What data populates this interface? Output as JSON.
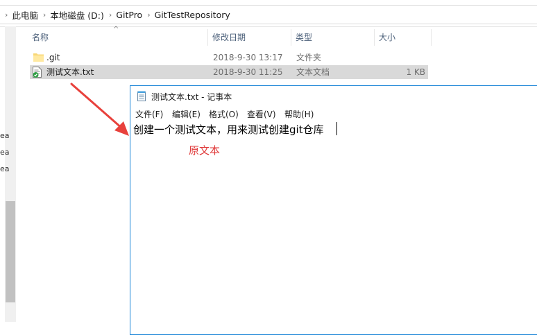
{
  "breadcrumb": {
    "items": [
      "此电脑",
      "本地磁盘 (D:)",
      "GitPro",
      "GitTestRepository"
    ],
    "separator": "›"
  },
  "left_pane": {
    "truncated_labels": [
      "ea",
      "ea",
      "ea"
    ]
  },
  "columns": {
    "name": "名称",
    "date": "修改日期",
    "type": "类型",
    "size": "大小"
  },
  "files": [
    {
      "name": ".git",
      "date": "2018-9-30 13:17",
      "type": "文件夹",
      "size": "",
      "icon": "folder-icon",
      "selected": false
    },
    {
      "name": "测试文本.txt",
      "date": "2018-9-30 11:25",
      "type": "文本文档",
      "size": "1 KB",
      "icon": "text-file-icon",
      "selected": true
    }
  ],
  "notepad": {
    "title": "测试文本.txt - 记事本",
    "menu": [
      "文件(F)",
      "编辑(E)",
      "格式(O)",
      "查看(V)",
      "帮助(H)"
    ],
    "content": "创建一个测试文本，用来测试创建git仓库"
  },
  "annotation": {
    "text": "原文本",
    "color": "#e03a3a"
  },
  "colors": {
    "selection": "#d9d9d9",
    "notepad_border": "#1883d7",
    "arrow": "#e8413c"
  }
}
